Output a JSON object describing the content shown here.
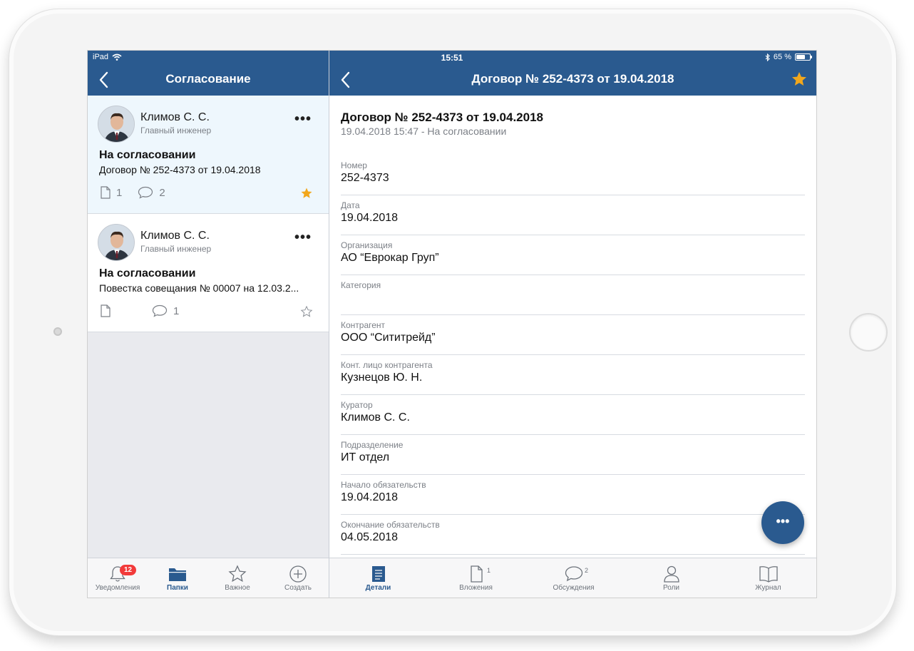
{
  "status_bar": {
    "device": "iPad",
    "time": "15:51",
    "battery_text": "65 %",
    "battery_level": 0.65
  },
  "left_nav": {
    "title": "Согласование"
  },
  "right_nav": {
    "title": "Договор № 252-4373 от 19.04.2018",
    "favorite": true
  },
  "list": [
    {
      "person_name": "Климов С. С.",
      "person_role": "Главный инженер",
      "status": "На согласовании",
      "document": "Договор № 252-4373 от 19.04.2018",
      "attachments": "1",
      "comments": "2",
      "favorite": true,
      "selected": true
    },
    {
      "person_name": "Климов С. С.",
      "person_role": "Главный инженер",
      "status": "На согласовании",
      "document": "Повестка совещания № 00007 на 12.03.2...",
      "attachments": "",
      "comments": "1",
      "favorite": false,
      "selected": false
    }
  ],
  "left_tabs": [
    {
      "label": "Уведомления",
      "icon": "bell-icon",
      "badge": "12"
    },
    {
      "label": "Папки",
      "icon": "folder-icon",
      "active": true
    },
    {
      "label": "Важное",
      "icon": "star-outline-icon"
    },
    {
      "label": "Создать",
      "icon": "plus-circle-icon"
    }
  ],
  "details": {
    "title": "Договор № 252-4373 от 19.04.2018",
    "subtitle": "19.04.2018 15:47 - На согласовании",
    "fields": [
      {
        "label": "Номер",
        "value": "252-4373"
      },
      {
        "label": "Дата",
        "value": "19.04.2018"
      },
      {
        "label": "Организация",
        "value": "АО “Еврокар Груп”"
      },
      {
        "label": "Категория",
        "value": ""
      },
      {
        "label": "Контрагент",
        "value": "ООО “Сититрейд”"
      },
      {
        "label": "Конт. лицо контрагента",
        "value": "Кузнецов Ю. Н."
      },
      {
        "label": "Куратор",
        "value": "Климов С. С."
      },
      {
        "label": "Подразделение",
        "value": "ИТ отдел"
      },
      {
        "label": "Начало обязательств",
        "value": "19.04.2018"
      },
      {
        "label": "Окончание обязательств",
        "value": "04.05.2018"
      }
    ]
  },
  "right_tabs": [
    {
      "label": "Детали",
      "icon": "document-list-icon",
      "active": true
    },
    {
      "label": "Вложения",
      "icon": "file-icon",
      "count": "1"
    },
    {
      "label": "Обсуждения",
      "icon": "comment-icon",
      "count": "2"
    },
    {
      "label": "Роли",
      "icon": "person-icon"
    },
    {
      "label": "Журнал",
      "icon": "book-icon"
    }
  ],
  "fab_label": "•••",
  "more_label": "•••",
  "colors": {
    "brand": "#2a5a8f",
    "star": "#f2a71c",
    "badge": "#f23a3a"
  }
}
